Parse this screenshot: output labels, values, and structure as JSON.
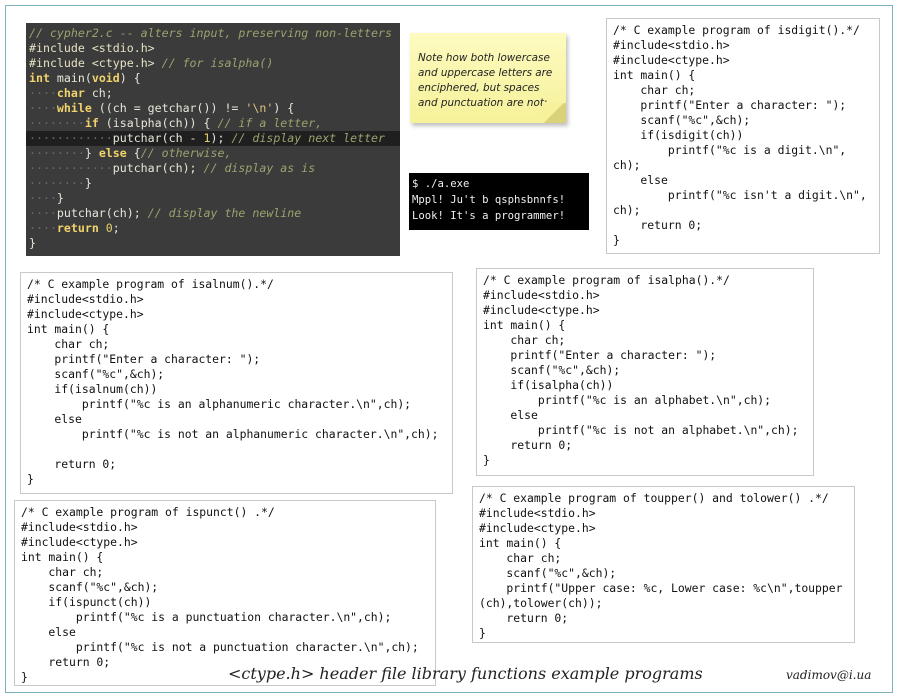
{
  "editor": {
    "lines": [
      {
        "tokens": [
          {
            "t": "// cypher2.c -- alters input, preserving non-letters",
            "c": "cmt"
          }
        ]
      },
      {
        "tokens": [
          {
            "t": "#include ",
            "c": "pp"
          },
          {
            "t": "<stdio.h>",
            "c": "pp"
          }
        ]
      },
      {
        "tokens": [
          {
            "t": "#include ",
            "c": "pp"
          },
          {
            "t": "<ctype.h>",
            "c": "pp"
          },
          {
            "t": " // for isalpha()",
            "c": "cmt"
          }
        ]
      },
      {
        "tokens": [
          {
            "t": "int",
            "c": "kw"
          },
          {
            "t": " main(",
            "c": "txt"
          },
          {
            "t": "void",
            "c": "kw"
          },
          {
            "t": ") {",
            "c": "txt"
          }
        ]
      },
      {
        "tokens": [
          {
            "t": "····",
            "c": "dot"
          },
          {
            "t": "char",
            "c": "kw"
          },
          {
            "t": " ch;",
            "c": "txt"
          }
        ]
      },
      {
        "tokens": [
          {
            "t": "····",
            "c": "dot"
          },
          {
            "t": "while",
            "c": "kw"
          },
          {
            "t": " ((ch = getchar()) != ",
            "c": "txt"
          },
          {
            "t": "'\\n'",
            "c": "str"
          },
          {
            "t": ") {",
            "c": "txt"
          }
        ]
      },
      {
        "tokens": [
          {
            "t": "········",
            "c": "dot"
          },
          {
            "t": "if",
            "c": "kw"
          },
          {
            "t": " (isalpha(ch)) { ",
            "c": "txt"
          },
          {
            "t": "// if a letter,",
            "c": "cmt"
          }
        ]
      },
      {
        "hl": true,
        "tokens": [
          {
            "t": "············",
            "c": "dot"
          },
          {
            "t": "putchar(ch - ",
            "c": "txt"
          },
          {
            "t": "1",
            "c": "num"
          },
          {
            "t": "); ",
            "c": "txt"
          },
          {
            "t": "// display next letter",
            "c": "cmt"
          }
        ]
      },
      {
        "tokens": [
          {
            "t": "········",
            "c": "dot"
          },
          {
            "t": "} ",
            "c": "txt"
          },
          {
            "t": "else",
            "c": "kw"
          },
          {
            "t": " {",
            "c": "txt"
          },
          {
            "t": "// otherwise,",
            "c": "cmt"
          }
        ]
      },
      {
        "tokens": [
          {
            "t": "············",
            "c": "dot"
          },
          {
            "t": "putchar(ch); ",
            "c": "txt"
          },
          {
            "t": "// display as is",
            "c": "cmt"
          }
        ]
      },
      {
        "tokens": [
          {
            "t": "········",
            "c": "dot"
          },
          {
            "t": "}",
            "c": "txt"
          }
        ]
      },
      {
        "tokens": [
          {
            "t": "····",
            "c": "dot"
          },
          {
            "t": "}",
            "c": "txt"
          }
        ]
      },
      {
        "tokens": [
          {
            "t": "····",
            "c": "dot"
          },
          {
            "t": "putchar(ch); ",
            "c": "txt"
          },
          {
            "t": "// display the newline",
            "c": "cmt"
          }
        ]
      },
      {
        "tokens": [
          {
            "t": "····",
            "c": "dot"
          },
          {
            "t": "return",
            "c": "kw"
          },
          {
            "t": " ",
            "c": "txt"
          },
          {
            "t": "0",
            "c": "num"
          },
          {
            "t": ";",
            "c": "txt"
          }
        ]
      },
      {
        "tokens": [
          {
            "t": "}",
            "c": "txt"
          }
        ]
      }
    ]
  },
  "note": {
    "text": "Note how both lowercase and uppercase letters are enciphered, but spaces and punctuation are not:"
  },
  "terminal": {
    "lines": [
      "$ ./a.exe",
      "Mppl! Ju't b qsphsbnnfs!",
      "Look! It's a programmer!"
    ]
  },
  "programs": {
    "isdigit": "/* C example program of isdigit().*/\n#include<stdio.h>\n#include<ctype.h>\nint main() {\n    char ch;\n    printf(\"Enter a character: \");\n    scanf(\"%c\",&ch);\n    if(isdigit(ch))\n        printf(\"%c is a digit.\\n\",\nch);\n    else\n        printf(\"%c isn't a digit.\\n\",\nch);\n    return 0;\n}",
    "isalnum": "/* C example program of isalnum().*/\n#include<stdio.h>\n#include<ctype.h>\nint main() {\n    char ch;\n    printf(\"Enter a character: \");\n    scanf(\"%c\",&ch);\n    if(isalnum(ch))\n        printf(\"%c is an alphanumeric character.\\n\",ch);\n    else\n        printf(\"%c is not an alphanumeric character.\\n\",ch);\n\n    return 0;\n}",
    "isalpha": "/* C example program of isalpha().*/\n#include<stdio.h>\n#include<ctype.h>\nint main() {\n    char ch;\n    printf(\"Enter a character: \");\n    scanf(\"%c\",&ch);\n    if(isalpha(ch))\n        printf(\"%c is an alphabet.\\n\",ch);\n    else\n        printf(\"%c is not an alphabet.\\n\",ch);\n    return 0;\n}",
    "ispunct": "/* C example program of ispunct() .*/\n#include<stdio.h>\n#include<ctype.h>\nint main() {\n    char ch;\n    scanf(\"%c\",&ch);\n    if(ispunct(ch))\n        printf(\"%c is a punctuation character.\\n\",ch);\n    else\n        printf(\"%c is not a punctuation character.\\n\",ch);\n    return 0;\n}",
    "toupper": "/* C example program of toupper() and tolower() .*/\n#include<stdio.h>\n#include<ctype.h>\nint main() {\n    char ch;\n    scanf(\"%c\",&ch);\n    printf(\"Upper case: %c, Lower case: %c\\n\",toupper\n(ch),tolower(ch));\n    return 0;\n}"
  },
  "caption": "<ctype.h> header file library functions example programs",
  "author": "vadimov@i.ua"
}
